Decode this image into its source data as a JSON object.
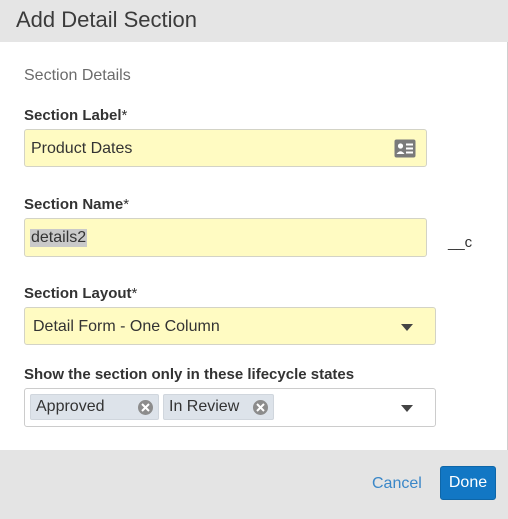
{
  "dialog": {
    "title": "Add Detail Section",
    "section_header": "Section Details"
  },
  "fields": {
    "section_label": {
      "label": "Section Label",
      "required_mark": "*",
      "value": "Product Dates",
      "icon": "contact-card-icon"
    },
    "section_name": {
      "label": "Section Name",
      "required_mark": "*",
      "value": "details2",
      "suffix": "__c"
    },
    "section_layout": {
      "label": "Section Layout",
      "required_mark": "*",
      "value": "Detail Form - One Column"
    },
    "lifecycle_states": {
      "label": "Show the section only in these lifecycle states",
      "selected": [
        "Approved",
        "In Review"
      ]
    }
  },
  "footer": {
    "cancel_label": "Cancel",
    "done_label": "Done"
  },
  "colors": {
    "input_highlight": "#fffbc2",
    "primary_button": "#1277c4",
    "link": "#3a87c8"
  }
}
